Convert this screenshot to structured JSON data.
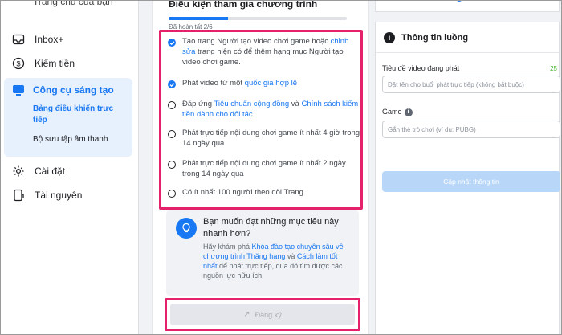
{
  "sidebar": {
    "cut_top_text": "Trang chủ của bạn",
    "items": [
      {
        "label": "Inbox+",
        "icon": "inbox-icon"
      },
      {
        "label": "Kiếm tiền",
        "icon": "dollar-icon"
      },
      {
        "label": "Cài đặt",
        "icon": "gear-icon"
      },
      {
        "label": "Tài nguyên",
        "icon": "resources-icon"
      }
    ],
    "active_section": {
      "label": "Công cụ sáng tạo",
      "icon": "creator-tools-icon",
      "subitems": [
        {
          "label": "Bảng điều khiển trực tiếp",
          "active": true
        },
        {
          "label": "Bộ sưu tập âm thanh",
          "active": false
        }
      ]
    }
  },
  "program": {
    "title": "Điều kiện tham gia chương trình",
    "progress_text": "Đã hoàn tất 2/6",
    "progress_fraction": 0.333,
    "accent_color": "#1877f2",
    "highlight_color": "#e6216b",
    "requirements": [
      {
        "done": true,
        "parts": [
          {
            "t": "Tạo trang Người tạo video chơi game hoặc "
          },
          {
            "t": "chỉnh sửa",
            "link": true
          },
          {
            "t": " trang hiện có để thêm hạng mục Người tạo video chơi game."
          }
        ]
      },
      {
        "done": true,
        "parts": [
          {
            "t": "Phát video từ một "
          },
          {
            "t": "quốc gia hợp lệ",
            "link": true
          }
        ]
      },
      {
        "done": false,
        "parts": [
          {
            "t": "Đáp ứng "
          },
          {
            "t": "Tiêu chuẩn cộng đồng",
            "link": true
          },
          {
            "t": " và "
          },
          {
            "t": "Chính sách kiếm tiền dành cho đối tác",
            "link": true
          }
        ]
      },
      {
        "done": false,
        "parts": [
          {
            "t": "Phát trực tiếp nội dung chơi game ít nhất 4 giờ trong 14 ngày qua"
          }
        ]
      },
      {
        "done": false,
        "parts": [
          {
            "t": "Phát trực tiếp nội dung chơi game ít nhất 2 ngày trong 14 ngày qua"
          }
        ]
      },
      {
        "done": false,
        "parts": [
          {
            "t": "Có ít nhất 100 người theo dõi Trang"
          }
        ]
      }
    ],
    "tip": {
      "title": "Bạn muốn đạt những mục tiêu này nhanh hơn?",
      "body_parts": [
        {
          "t": "Hãy khám phá "
        },
        {
          "t": "Khóa đào tạo chuyên sâu về chương trình Thăng hạng",
          "link": true
        },
        {
          "t": " và "
        },
        {
          "t": "Cách làm tốt nhất",
          "link": true
        },
        {
          "t": " để phát trực tiếp, qua đó tìm được các nguồn lực hữu ích."
        }
      ],
      "icon": "lightbulb-icon"
    },
    "register_label": "Đăng ký"
  },
  "stream_info": {
    "title": "Thông tin luồng",
    "video_title_label": "Tiêu đề video đang phát",
    "video_title_count": "25",
    "video_title_placeholder": "Đặt tên cho buổi phát trực tiếp (không bắt buộc)",
    "game_label": "Game",
    "game_placeholder": "Gắn thẻ trò chơi (ví dụ: PUBG)",
    "update_label": "Cập nhật thông tin"
  }
}
